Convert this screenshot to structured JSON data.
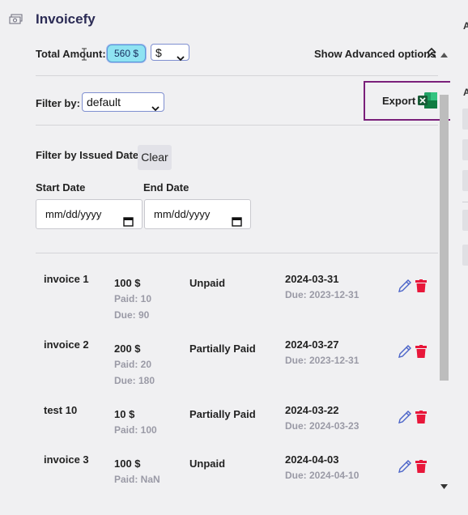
{
  "app": {
    "title": "Invoicefy"
  },
  "summary": {
    "total_label": "Total Amount:",
    "total_value": "560 $",
    "currency_selected": "$",
    "advanced_toggle": "Show Advanced options"
  },
  "filter": {
    "label": "Filter by:",
    "selected": "default"
  },
  "export": {
    "label": "Export"
  },
  "date_filter": {
    "label": "Filter by Issued Date:",
    "clear_label": "Clear",
    "start_label": "Start Date",
    "end_label": "End Date",
    "start_value": "mm/dd/yyyy",
    "end_value": "mm/dd/yyyy"
  },
  "invoices": [
    {
      "name": "invoice 1",
      "amount": "100 $",
      "paid": "Paid: 10",
      "due": "Due: 90",
      "status": "Unpaid",
      "date": "2024-03-31",
      "due_date": "Due: 2023-12-31"
    },
    {
      "name": "invoice 2",
      "amount": "200 $",
      "paid": "Paid: 20",
      "due": "Due: 180",
      "status": "Partially Paid",
      "date": "2024-03-27",
      "due_date": "Due: 2023-12-31"
    },
    {
      "name": "test 10",
      "amount": "10 $",
      "paid": "Paid: 100",
      "due": "",
      "status": "Partially Paid",
      "date": "2024-03-22",
      "due_date": "Due: 2024-03-23"
    },
    {
      "name": "invoice 3",
      "amount": "100 $",
      "paid": "Paid: NaN",
      "due": "",
      "status": "Unpaid",
      "date": "2024-04-03",
      "due_date": "Due: 2024-04-10"
    }
  ],
  "right_panel": {
    "letter_top": "A",
    "letter_mid": "A"
  },
  "colors": {
    "accent": "#2b2b55",
    "delete": "#e8173a",
    "edit": "#4a63c8",
    "pill": "#8fe3f2",
    "export_border": "#7a1f7a"
  }
}
